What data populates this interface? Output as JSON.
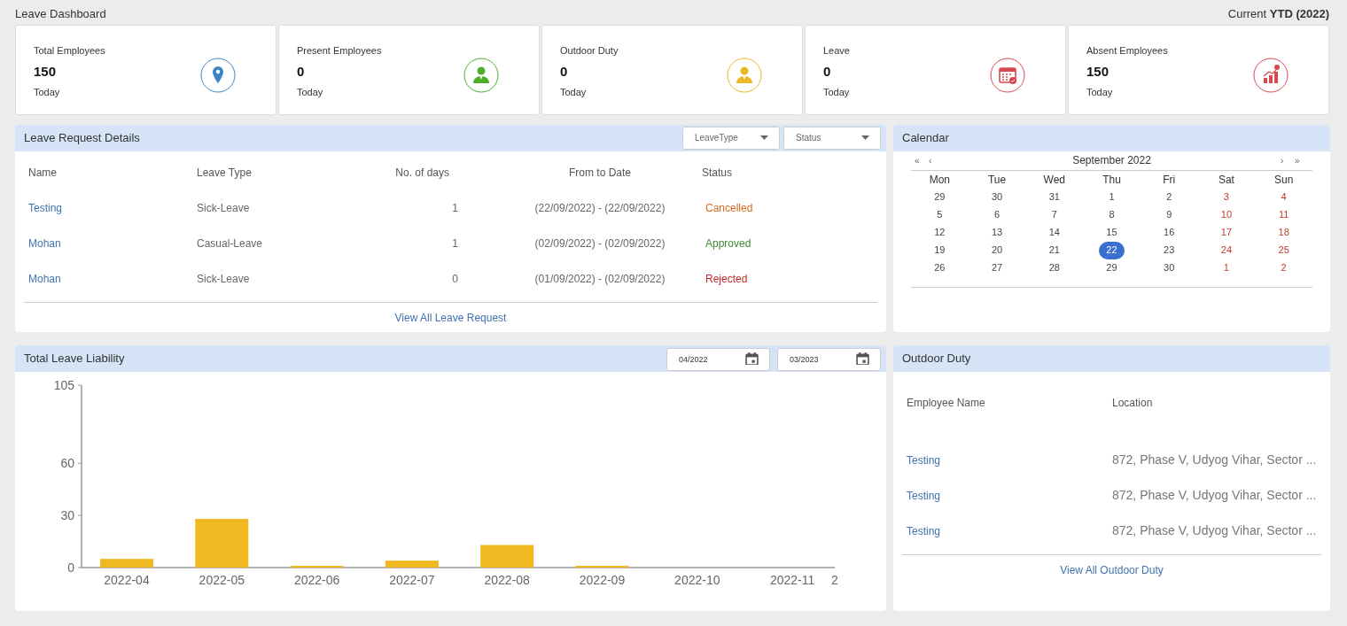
{
  "page": {
    "title": "Leave Dashboard",
    "period_prefix": "Current",
    "period": "YTD (2022)"
  },
  "stats": [
    {
      "label": "Total Employees",
      "value": "150",
      "sub": "Today",
      "kind": "pin",
      "color": "#3d85c6"
    },
    {
      "label": "Present Employees",
      "value": "0",
      "sub": "Today",
      "kind": "person",
      "color": "#4caf2a"
    },
    {
      "label": "Outdoor Duty",
      "value": "0",
      "sub": "Today",
      "kind": "person",
      "color": "#e8b825"
    },
    {
      "label": "Leave",
      "value": "0",
      "sub": "Today",
      "kind": "calendar",
      "color": "#d9474f"
    },
    {
      "label": "Absent Employees",
      "value": "150",
      "sub": "Today",
      "kind": "growth",
      "color": "#d9474f"
    }
  ],
  "leave_requests": {
    "title": "Leave Request Details",
    "filters": [
      {
        "placeholder": "LeaveType"
      },
      {
        "placeholder": "Status"
      }
    ],
    "columns": [
      "Name",
      "Leave Type",
      "No. of days",
      "From to Date",
      "Status"
    ],
    "rows": [
      {
        "name": "Testing",
        "leave_type": "Sick-Leave",
        "days": "1",
        "dates": "(22/09/2022) - (22/09/2022)",
        "status": "Cancelled",
        "color": "#d2691e"
      },
      {
        "name": "Mohan",
        "leave_type": "Casual-Leave",
        "days": "1",
        "dates": "(02/09/2022) - (02/09/2022)",
        "status": "Approved",
        "color": "#3f8a2f"
      },
      {
        "name": "Mohan",
        "leave_type": "Sick-Leave",
        "days": "0",
        "dates": "(01/09/2022) - (02/09/2022)",
        "status": "Rejected",
        "color": "#c62828"
      }
    ],
    "footer_link": "View All Leave Request"
  },
  "calendar": {
    "title": "Calendar",
    "nav": [
      "«",
      "‹",
      "›",
      "»"
    ],
    "month": "September 2022",
    "weekdays": [
      {
        "label": "Mon",
        "weekend": false
      },
      {
        "label": "Tue",
        "weekend": false
      },
      {
        "label": "Wed",
        "weekend": false
      },
      {
        "label": "Thu",
        "weekend": false
      },
      {
        "label": "Fri",
        "weekend": false
      },
      {
        "label": "Sat",
        "weekend": true
      },
      {
        "label": "Sun",
        "weekend": true
      }
    ],
    "weeks": [
      [
        {
          "day": "29",
          "selected": false
        },
        {
          "day": "30",
          "selected": false
        },
        {
          "day": "31",
          "selected": false
        },
        {
          "day": "1",
          "selected": false
        },
        {
          "day": "2",
          "selected": false
        },
        {
          "day": "3",
          "selected": false
        },
        {
          "day": "4",
          "selected": false
        }
      ],
      [
        {
          "day": "5",
          "selected": false
        },
        {
          "day": "6",
          "selected": false
        },
        {
          "day": "7",
          "selected": false
        },
        {
          "day": "8",
          "selected": false
        },
        {
          "day": "9",
          "selected": false
        },
        {
          "day": "10",
          "selected": false
        },
        {
          "day": "11",
          "selected": false
        }
      ],
      [
        {
          "day": "12",
          "selected": false
        },
        {
          "day": "13",
          "selected": false
        },
        {
          "day": "14",
          "selected": false
        },
        {
          "day": "15",
          "selected": false
        },
        {
          "day": "16",
          "selected": false
        },
        {
          "day": "17",
          "selected": false
        },
        {
          "day": "18",
          "selected": false
        }
      ],
      [
        {
          "day": "19",
          "selected": false
        },
        {
          "day": "20",
          "selected": false
        },
        {
          "day": "21",
          "selected": false
        },
        {
          "day": "22",
          "selected": true
        },
        {
          "day": "23",
          "selected": false
        },
        {
          "day": "24",
          "selected": false
        },
        {
          "day": "25",
          "selected": false
        }
      ],
      [
        {
          "day": "26",
          "selected": false
        },
        {
          "day": "27",
          "selected": false
        },
        {
          "day": "28",
          "selected": false
        },
        {
          "day": "29",
          "selected": false
        },
        {
          "day": "30",
          "selected": false
        },
        {
          "day": "1",
          "selected": false
        },
        {
          "day": "2",
          "selected": false
        }
      ]
    ]
  },
  "liability": {
    "title": "Total Leave Liability",
    "from": "04/2022",
    "to": "03/2023",
    "chart_data": {
      "type": "bar",
      "categories": [
        "2022-04",
        "2022-05",
        "2022-06",
        "2022-07",
        "2022-08",
        "2022-09",
        "2022-10",
        "2022-11",
        "2"
      ],
      "series": [
        {
          "color": "#f0b921",
          "values": [
            5,
            28,
            1,
            4,
            13,
            1,
            0,
            0,
            null
          ]
        }
      ],
      "ylim": [
        0,
        105
      ],
      "yticks": [
        0,
        30,
        60,
        105
      ]
    }
  },
  "outdoor_duty": {
    "title": "Outdoor Duty",
    "columns": [
      "Employee Name",
      "Location"
    ],
    "rows": [
      {
        "name": "Testing",
        "location": "872, Phase V, Udyog Vihar, Sector ..."
      },
      {
        "name": "Testing",
        "location": "872, Phase V, Udyog Vihar, Sector ..."
      },
      {
        "name": "Testing",
        "location": "872, Phase V, Udyog Vihar, Sector ..."
      }
    ],
    "footer_link": "View All Outdoor Duty"
  }
}
